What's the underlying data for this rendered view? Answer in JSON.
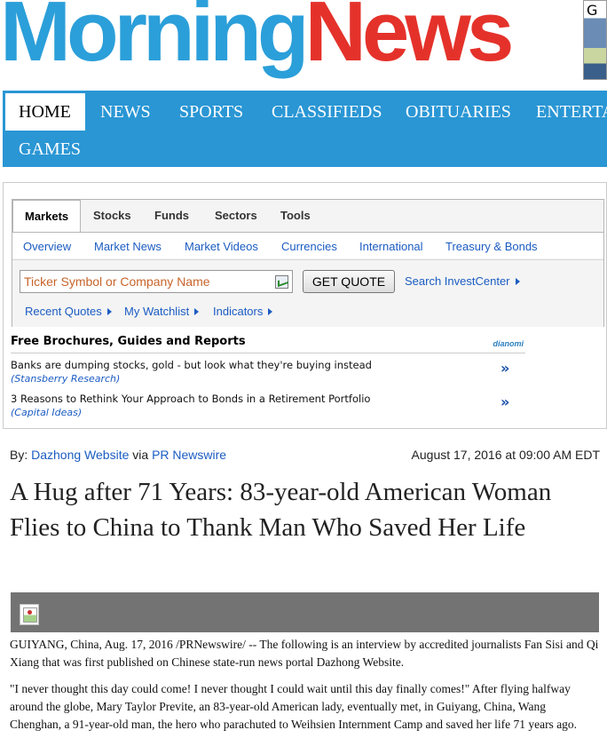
{
  "masthead": {
    "logo_part1": "Morning",
    "logo_part2": "News",
    "ad_thumb_letter": "G"
  },
  "nav": {
    "items": [
      "HOME",
      "NEWS",
      "SPORTS",
      "CLASSIFIEDS",
      "OBITUARIES",
      "ENTERTA",
      "GAMES"
    ],
    "active": "HOME"
  },
  "markets": {
    "tabs": [
      "Markets",
      "Stocks",
      "Funds",
      "Sectors",
      "Tools"
    ],
    "subnav": [
      "Overview",
      "Market News",
      "Market Videos",
      "Currencies",
      "International",
      "Treasury & Bonds"
    ],
    "ticker_placeholder": "Ticker Symbol or Company Name",
    "get_quote_label": "GET QUOTE",
    "search_investcenter": "Search InvestCenter",
    "quick_links": [
      "Recent Quotes",
      "My Watchlist",
      "Indicators"
    ]
  },
  "brochures": {
    "heading": "Free Brochures, Guides and Reports",
    "sponsor": "dianomi",
    "items": [
      {
        "title": "Banks are dumping stocks, gold - but look what they're buying instead",
        "source": "(Stansberry Research)"
      },
      {
        "title": "3 Reasons to Rethink Your Approach to Bonds in a Retirement Portfolio",
        "source": "(Capital Ideas)"
      }
    ],
    "arrow": "»"
  },
  "article": {
    "by_prefix": "By:",
    "author": "Dazhong Website",
    "via": "via",
    "source": "PR Newswire",
    "date": "August 17, 2016 at 09:00 AM EDT",
    "headline": "A Hug after 71 Years: 83-year-old American Woman Flies to China to Thank Man Who Saved Her Life",
    "paragraphs": [
      "GUIYANG, China, Aug. 17, 2016 /PRNewswire/ -- The following is an interview by accredited journalists Fan Sisi and Qi Xiang that was first published on Chinese state-run news portal Dazhong Website.",
      "\"I never thought this day could come! I never thought I could wait until this day finally comes!\" After flying halfway around the globe, Mary Taylor Previte, an 83-year-old American lady, eventually met, in Guiyang, China, Wang Chenghan, a 91-year-old man, the hero who parachuted to Weihsien Internment Camp and saved her life 71 years ago."
    ]
  }
}
